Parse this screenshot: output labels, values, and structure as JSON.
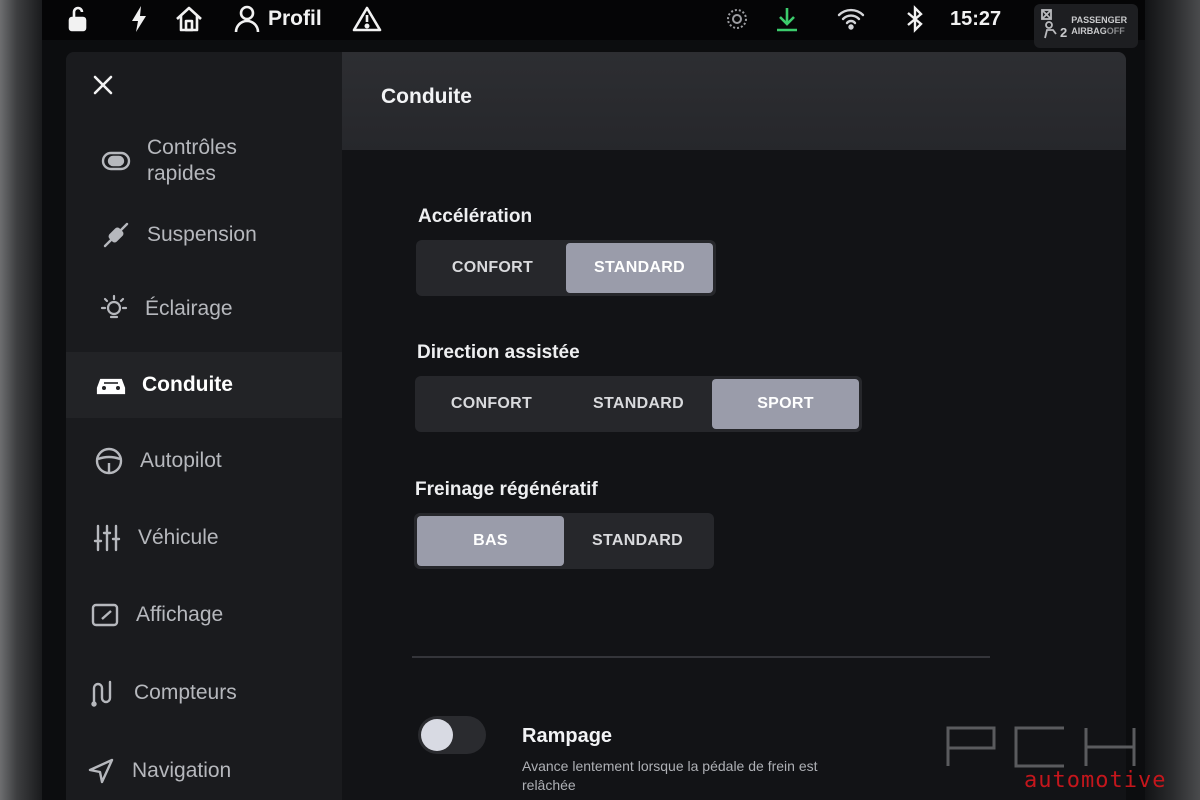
{
  "statusbar": {
    "icons": [
      "lock-icon",
      "lightning-icon",
      "home-icon",
      "user-icon",
      "warning-icon",
      "brightness-icon",
      "download-icon",
      "wifi-icon",
      "bluetooth-icon"
    ],
    "profile_label": "Profil",
    "time": "15:27",
    "airbag": {
      "line1": "PASSENGER",
      "line2": "AIRBAG",
      "line2_suffix": "OFF",
      "seat_number": "2"
    }
  },
  "sidebar": {
    "close_icon": "close-icon",
    "items": [
      {
        "id": "controles-rapides",
        "label_line1": "Contrôles",
        "label_line2": "rapides",
        "icon": "toggle-icon"
      },
      {
        "id": "suspension",
        "label": "Suspension",
        "icon": "suspension-icon"
      },
      {
        "id": "eclairage",
        "label": "Éclairage",
        "icon": "light-bulb-icon"
      },
      {
        "id": "conduite",
        "label": "Conduite",
        "icon": "car-icon",
        "active": true
      },
      {
        "id": "autopilot",
        "label": "Autopilot",
        "icon": "steering-wheel-icon"
      },
      {
        "id": "vehicule",
        "label": "Véhicule",
        "icon": "sliders-icon"
      },
      {
        "id": "affichage",
        "label": "Affichage",
        "icon": "display-icon"
      },
      {
        "id": "compteurs",
        "label": "Compteurs",
        "icon": "trip-icon"
      },
      {
        "id": "navigation",
        "label": "Navigation",
        "icon": "navigation-arrow-icon"
      }
    ]
  },
  "panel": {
    "title": "Conduite",
    "acceleration": {
      "label": "Accélération",
      "options": [
        "CONFORT",
        "STANDARD"
      ],
      "selected": "STANDARD"
    },
    "steering": {
      "label": "Direction assistée",
      "options": [
        "CONFORT",
        "STANDARD",
        "SPORT"
      ],
      "selected": "SPORT"
    },
    "regen": {
      "label": "Freinage régénératif",
      "options": [
        "BAS",
        "STANDARD"
      ],
      "selected": "BAS"
    },
    "creep": {
      "title": "Rampage",
      "description": "Avance lentement lorsque la pédale de frein est relâchée",
      "enabled": false
    }
  },
  "watermark": {
    "letters": "PCH",
    "sub": "automotive"
  },
  "colors": {
    "selected_segment": "#9a9caa",
    "download_icon": "#3ccc6c",
    "watermark_red": "#c4161c"
  }
}
